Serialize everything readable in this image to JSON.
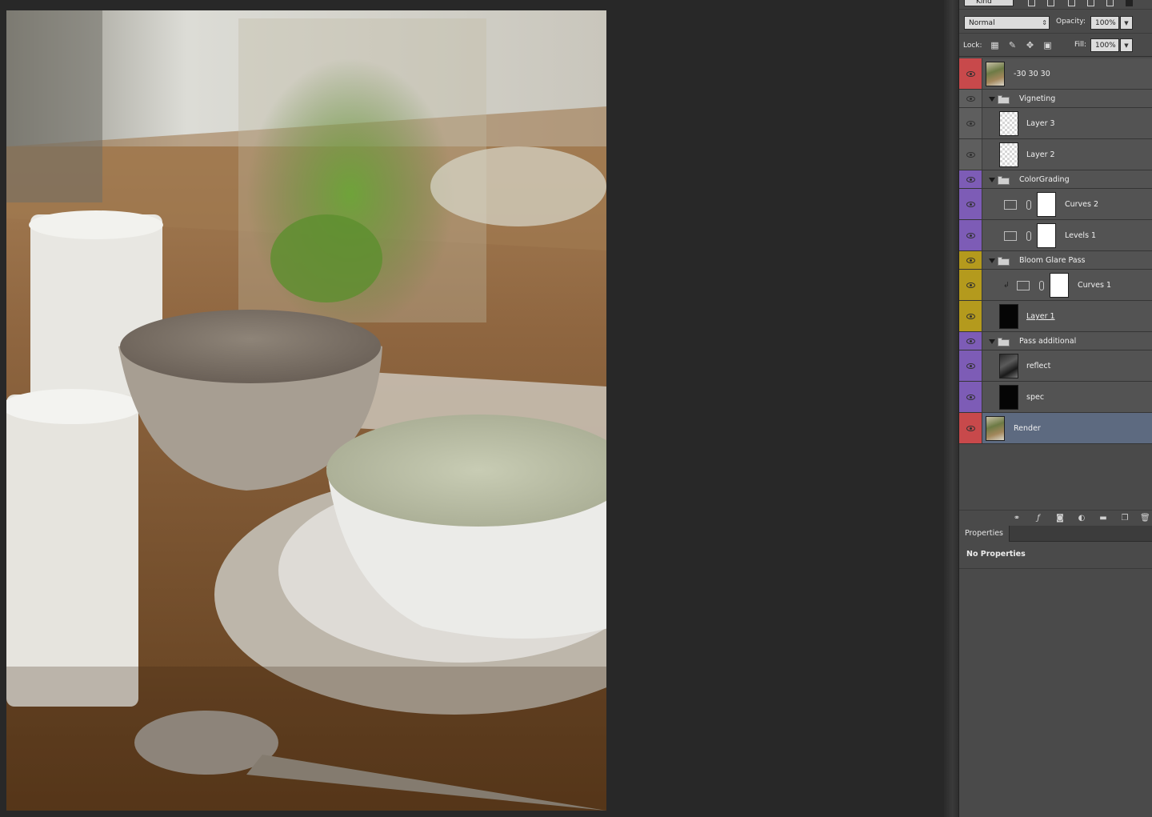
{
  "layers_panel": {
    "filter": {
      "kind_label": "Kind"
    },
    "blend_mode": "Normal",
    "opacity_label": "Opacity:",
    "opacity_value": "100%",
    "lock_label": "Lock:",
    "fill_label": "Fill:",
    "fill_value": "100%",
    "layers": [
      {
        "name": "-30 30 30",
        "type": "layer",
        "thumb": "photo",
        "color_tag": "#c8494b",
        "indent": 0
      },
      {
        "name": "Vigneting",
        "type": "group",
        "color_tag": "#5e5e5e",
        "indent": 0
      },
      {
        "name": "Layer 3",
        "type": "layer",
        "thumb": "transparent",
        "color_tag": "#5e5e5e",
        "indent": 1
      },
      {
        "name": "Layer 2",
        "type": "layer",
        "thumb": "transparent",
        "color_tag": "#5e5e5e",
        "indent": 1
      },
      {
        "name": "ColorGrading",
        "type": "group",
        "color_tag": "#7d5cb6",
        "indent": 0
      },
      {
        "name": "Curves 2",
        "type": "adjustment",
        "adj": "curves",
        "color_tag": "#7d5cb6",
        "indent": 1
      },
      {
        "name": "Levels 1",
        "type": "adjustment",
        "adj": "levels",
        "color_tag": "#7d5cb6",
        "indent": 1
      },
      {
        "name": "Bloom Glare Pass",
        "type": "group",
        "color_tag": "#b49a1d",
        "indent": 0
      },
      {
        "name": "Curves 1",
        "type": "adjustment",
        "adj": "curves",
        "clipped": true,
        "color_tag": "#b49a1d",
        "indent": 1
      },
      {
        "name": "Layer 1",
        "type": "layer",
        "thumb": "black",
        "underline": true,
        "color_tag": "#b49a1d",
        "indent": 1
      },
      {
        "name": "Pass additional",
        "type": "group",
        "color_tag": "#7d5cb6",
        "indent": 0
      },
      {
        "name": "reflect",
        "type": "layer",
        "thumb": "dark-photo",
        "color_tag": "#7d5cb6",
        "indent": 1
      },
      {
        "name": "spec",
        "type": "layer",
        "thumb": "black",
        "color_tag": "#7d5cb6",
        "indent": 1
      },
      {
        "name": "Render",
        "type": "layer",
        "thumb": "photo",
        "color_tag": "#c8494b",
        "selected": true,
        "indent": 0
      }
    ],
    "footer_icons": [
      "link-icon",
      "fx-icon",
      "mask-icon",
      "adjustment-icon",
      "folder-icon",
      "new-layer-icon",
      "trash-icon"
    ]
  },
  "properties_panel": {
    "tab_label": "Properties",
    "message": "No Properties"
  },
  "colors": {
    "panel_bg": "#4a4a4a",
    "selected_layer": "#5d6a80",
    "canvas_bg": "#282828"
  }
}
